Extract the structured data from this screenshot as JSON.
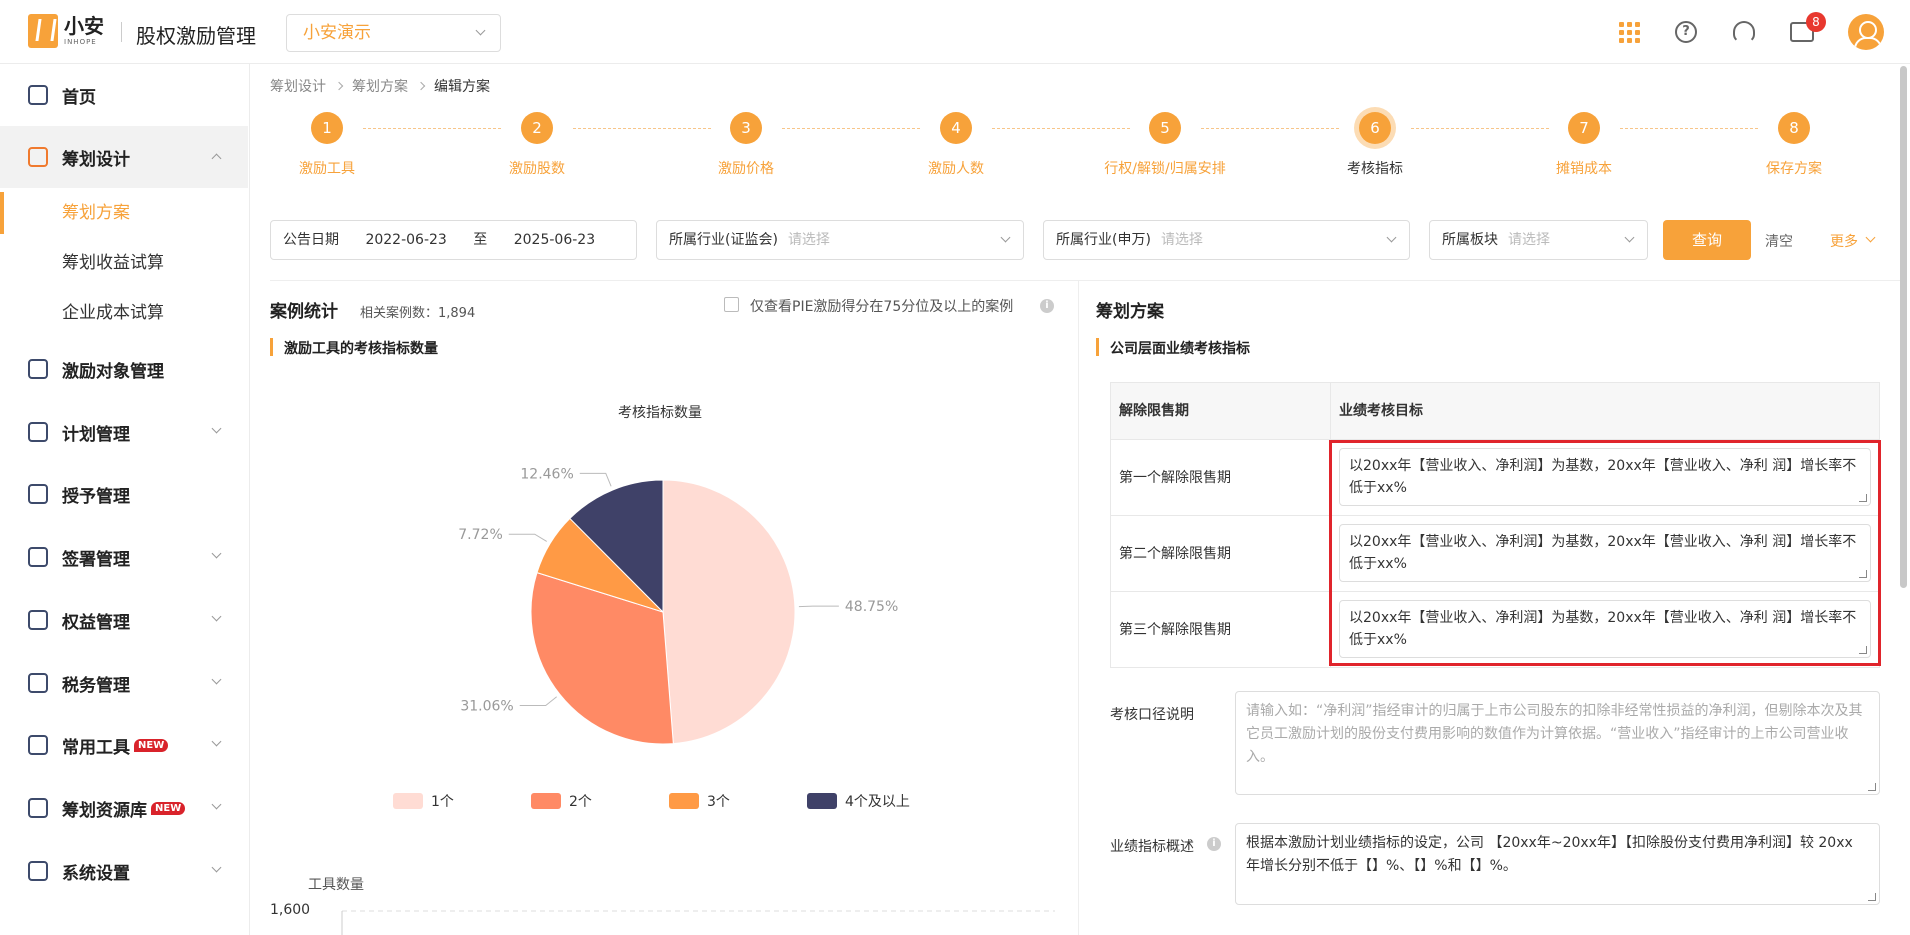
{
  "header": {
    "logo_cn": "小安",
    "logo_en": "INHOPE",
    "app_title": "股权激励管理",
    "company": "小安演示",
    "message_count": "8",
    "icons": [
      "apps-grid-icon",
      "help-icon",
      "headset-icon",
      "message-icon",
      "avatar-icon"
    ]
  },
  "sidebar": {
    "items": [
      {
        "label": "首页",
        "icon": "home-icon"
      },
      {
        "label": "筹划设计",
        "icon": "edit-icon",
        "open": true
      },
      {
        "label": "激励对象管理",
        "icon": "users-icon"
      },
      {
        "label": "计划管理",
        "icon": "plan-icon"
      },
      {
        "label": "授予管理",
        "icon": "grant-icon"
      },
      {
        "label": "签署管理",
        "icon": "sign-icon"
      },
      {
        "label": "权益管理",
        "icon": "equity-icon"
      },
      {
        "label": "税务管理",
        "icon": "tax-icon"
      },
      {
        "label": "常用工具",
        "icon": "toolbox-icon",
        "badge": "NEW"
      },
      {
        "label": "筹划资源库",
        "icon": "layers-icon",
        "badge": "NEW"
      },
      {
        "label": "系统设置",
        "icon": "settings-icon"
      }
    ],
    "sub_items": [
      "筹划方案",
      "筹划收益试算",
      "企业成本试算"
    ]
  },
  "breadcrumb": [
    "筹划设计",
    "筹划方案",
    "编辑方案"
  ],
  "steps": [
    {
      "num": "1",
      "label": "激励工具"
    },
    {
      "num": "2",
      "label": "激励股数"
    },
    {
      "num": "3",
      "label": "激励价格"
    },
    {
      "num": "4",
      "label": "激励人数"
    },
    {
      "num": "5",
      "label": "行权/解锁/归属安排"
    },
    {
      "num": "6",
      "label": "考核指标",
      "current": true
    },
    {
      "num": "7",
      "label": "摊销成本"
    },
    {
      "num": "8",
      "label": "保存方案"
    }
  ],
  "filters": {
    "date_label": "公告日期",
    "date_from": "2022-06-23",
    "date_to_sep": "至",
    "date_to": "2025-06-23",
    "industry_csrc_label": "所属行业(证监会)",
    "industry_sw_label": "所属行业(申万)",
    "board_label": "所属板块",
    "placeholder": "请选择",
    "query": "查询",
    "clear": "清空",
    "more": "更多"
  },
  "stats": {
    "title": "案例统计",
    "case_count": "相关案例数：1,894",
    "pie_filter_label": "仅查看PIE激励得分在75分位及以上的案例",
    "sub_title": "激励工具的考核指标数量"
  },
  "chart_data": [
    {
      "type": "pie",
      "title": "考核指标数量",
      "series": [
        {
          "name": "1个",
          "value": 48.75,
          "label": "48.75%",
          "color": "#ffdcd4"
        },
        {
          "name": "2个",
          "value": 31.06,
          "label": "31.06%",
          "color": "#ff8a65"
        },
        {
          "name": "3个",
          "value": 7.72,
          "label": "7.72%",
          "color": "#ff9a45"
        },
        {
          "name": "4个及以上",
          "value": 12.46,
          "label": "12.46%",
          "color": "#3f4168"
        }
      ],
      "legend": "bottom"
    },
    {
      "type": "bar",
      "ylabel": "工具数量",
      "y_ticks": [
        "1,600"
      ]
    }
  ],
  "plan": {
    "title": "筹划方案",
    "sub_title": "公司层面业绩考核指标",
    "table_headers": [
      "解除限售期",
      "业绩考核目标"
    ],
    "rows": [
      {
        "period": "第一个解除限售期",
        "target": "以20xx年【营业收入、净利润】为基数，20xx年【营业收入、净利 润】增长率不低于xx%"
      },
      {
        "period": "第二个解除限售期",
        "target": "以20xx年【营业收入、净利润】为基数，20xx年【营业收入、净利 润】增长率不低于xx%"
      },
      {
        "period": "第三个解除限售期",
        "target": "以20xx年【营业收入、净利润】为基数，20xx年【营业收入、净利 润】增长率不低于xx%"
      }
    ],
    "criteria_label": "考核口径说明",
    "criteria_placeholder": "请输入如：“净利润”指经审计的归属于上市公司股东的扣除非经常性损益的净利润，但剔除本次及其它员工激励计划的股份支付费用影响的数值作为计算依据。“营业收入”指经审计的上市公司营业收入。",
    "summary_label": "业绩指标概述",
    "summary_value": "根据本激励计划业绩指标的设定，公司 【20xx年~20xx年】【扣除股份支付费用净利润】较 20xx 年增长分别不低于【】%、【】%和【】%。"
  }
}
